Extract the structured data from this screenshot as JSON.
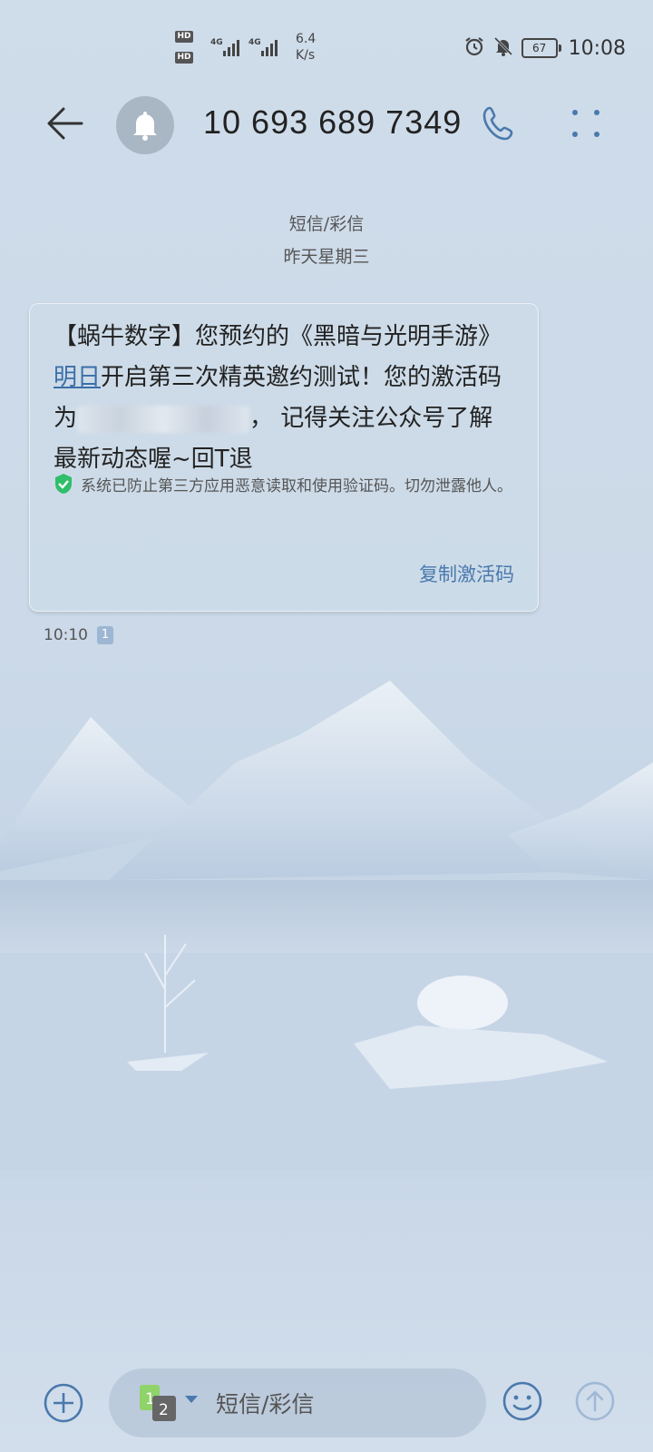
{
  "status_bar": {
    "hd1": "HD",
    "hd2": "HD",
    "net1": "4G",
    "net2": "4G",
    "speed_value": "6.4",
    "speed_unit": "K/s",
    "battery": "67",
    "time": "10:08"
  },
  "header": {
    "contact": "10 693 689 7349",
    "avatar_icon": "bell-icon",
    "accent": "#4a79ad"
  },
  "meta": {
    "type": "短信/彩信",
    "date": "昨天星期三"
  },
  "message": {
    "part1": "【蜗牛数字】您预约的《黑暗与光明手游》",
    "link": "明日",
    "part2": "开启第三次精英邀约测试！您的激活码为",
    "part3": "， 记得关注公众号了解最新动态喔~回T退",
    "security_note": "系统已防止第三方应用恶意读取和使用验证码。切勿泄露他人。",
    "copy_action": "复制激活码",
    "time": "10:10",
    "sim": "1"
  },
  "input": {
    "placeholder": "短信/彩信",
    "sim1": "1",
    "sim2": "2"
  }
}
